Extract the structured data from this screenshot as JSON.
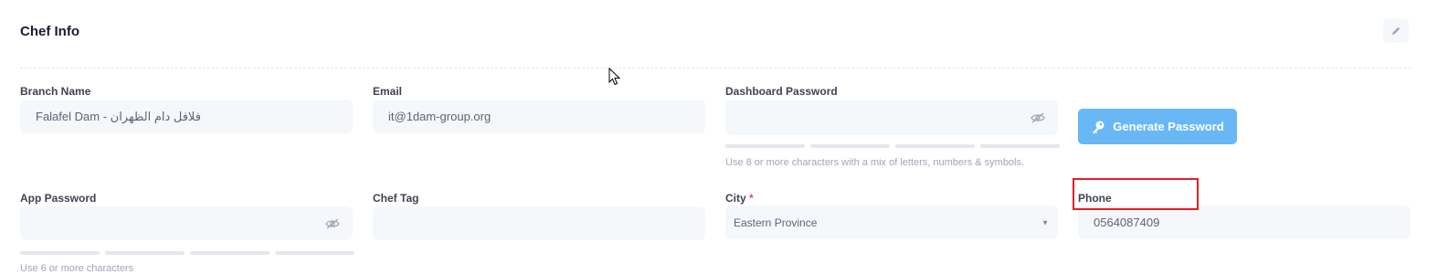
{
  "header": {
    "title": "Chef Info"
  },
  "fields": {
    "branch_name": {
      "label": "Branch Name",
      "value": "Falafel Dam - فلافل دام الظهران"
    },
    "email": {
      "label": "Email",
      "value": "it@1dam-group.org"
    },
    "dashboard_password": {
      "label": "Dashboard Password",
      "value": "",
      "hint": "Use 8 or more characters with a mix of letters, numbers & symbols."
    },
    "generate_password_label": "Generate Password",
    "app_password": {
      "label": "App Password",
      "value": "",
      "hint": "Use 6 or more characters"
    },
    "chef_tag": {
      "label": "Chef Tag",
      "value": ""
    },
    "city": {
      "label": "City",
      "required_mark": "*",
      "value": "Eastern Province"
    },
    "phone": {
      "label": "Phone",
      "value": "0564087409"
    }
  },
  "icons": {
    "edit": "pencil-icon",
    "visibility": "eye-slash-icon",
    "generate": "key-icon",
    "dropdown": "caret-down-icon"
  },
  "colors": {
    "primary_button": "#69b8f5",
    "input_bg": "#f5f8fa",
    "highlight": "#e41e26",
    "required": "#f1416c"
  }
}
